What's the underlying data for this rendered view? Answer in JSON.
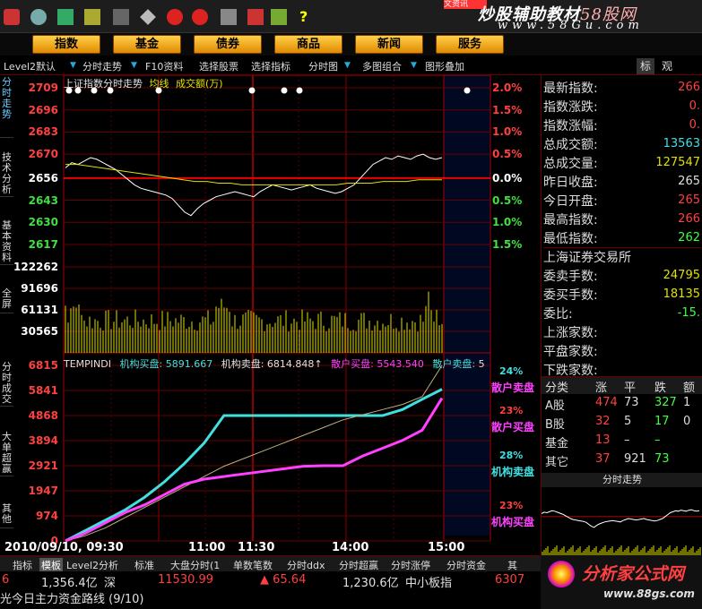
{
  "topbar": {
    "brand_line1": "炒股辅助教材",
    "brand_line1_accent": "58股网",
    "brand_line2": "www.58Gu.com",
    "partial_tab": "文资讯"
  },
  "nav": {
    "items": [
      "指数",
      "基金",
      "债券",
      "商品",
      "新闻",
      "服务"
    ]
  },
  "toolbar": {
    "items": [
      "Level2默认",
      "分时走势",
      "F10资料",
      "选择股票",
      "选择指标",
      "分时图",
      "多图组合",
      "图形叠加"
    ],
    "right_tabs": [
      "标",
      "观"
    ]
  },
  "left_tabs": [
    "分时走势",
    "技术分析",
    "基本资料",
    "全屏",
    "分时成交",
    "大单超赢",
    "其他"
  ],
  "chart": {
    "header": "上证指数分时走势",
    "header_avg": "均线",
    "header_vol": "成交额(万)",
    "price_labels": [
      "2709",
      "2696",
      "2683",
      "2670",
      "2656",
      "2643",
      "2630",
      "2617"
    ],
    "pct_labels": [
      "2.0%",
      "1.5%",
      "1.0%",
      "0.5%",
      "0.0%",
      "0.5%",
      "1.0%",
      "1.5%"
    ],
    "vol_labels": [
      "122262",
      "91696",
      "61131",
      "30565"
    ],
    "indicator_name": "TEMPINDI",
    "ind_legend": [
      {
        "label": "机构买盘:",
        "value": "5891.667",
        "color": "#40e0e0"
      },
      {
        "label": "机构卖盘:",
        "value": "6814.848↑",
        "color": "#e0e0e0"
      },
      {
        "label": "散户买盘:",
        "value": "5543.540",
        "color": "#ff40ff"
      },
      {
        "label": "散户卖盘:",
        "value": "5",
        "color": "#e0e0e0"
      }
    ],
    "ind_labels": [
      "6815",
      "5841",
      "4868",
      "3894",
      "2921",
      "1947",
      "974",
      "0"
    ],
    "ind_right_pcts": [
      "24%",
      "23%",
      "28%",
      "23%"
    ],
    "ind_right_names": [
      "散户卖盘",
      "散户买盘",
      "机构卖盘",
      "机构买盘"
    ],
    "time_labels": [
      "2010/09/10, 09:30",
      "11:00",
      "11:30",
      "14:00",
      "15:00"
    ]
  },
  "chart_data": {
    "type": "line",
    "title": "上证指数分时走势",
    "price_range": [
      2617,
      2709
    ],
    "baseline": 2656,
    "price_series": [
      2662,
      2665,
      2664,
      2666,
      2668,
      2667,
      2665,
      2663,
      2661,
      2658,
      2655,
      2652,
      2650,
      2649,
      2648,
      2647,
      2646,
      2644,
      2640,
      2636,
      2634,
      2638,
      2641,
      2643,
      2645,
      2646,
      2647,
      2648,
      2647,
      2646,
      2645,
      2648,
      2650,
      2652,
      2651,
      2650,
      2649,
      2650,
      2651,
      2652,
      2650,
      2649,
      2648,
      2647,
      2648,
      2650,
      2652,
      2656,
      2660,
      2664,
      2666,
      2668,
      2667,
      2669,
      2668,
      2667,
      2669,
      2670,
      2668,
      2667,
      2668
    ],
    "avg_series": [
      2664,
      2664,
      2663,
      2662,
      2661,
      2660,
      2659,
      2658,
      2657,
      2656,
      2655,
      2654,
      2654,
      2653,
      2653,
      2652,
      2652,
      2652,
      2652,
      2652,
      2652,
      2652,
      2652,
      2652,
      2653,
      2653,
      2653,
      2654,
      2654,
      2654,
      2655,
      2655,
      2655
    ],
    "vol_range": [
      0,
      122262
    ],
    "ind_range": [
      0,
      6815
    ],
    "series": [
      {
        "name": "机构买盘",
        "values": [
          0,
          400,
          800,
          1200,
          1700,
          2300,
          3000,
          3800,
          4868,
          4868,
          4868,
          4868,
          4868,
          4868,
          4868,
          4868,
          4868,
          5100,
          5500,
          5891
        ]
      },
      {
        "name": "机构卖盘",
        "values": [
          0,
          200,
          500,
          900,
          1300,
          1700,
          2100,
          2500,
          2900,
          3200,
          3500,
          3800,
          4100,
          4400,
          4700,
          4900,
          5100,
          5300,
          5600,
          6815
        ]
      },
      {
        "name": "散户买盘",
        "values": [
          0,
          300,
          700,
          1100,
          1400,
          1800,
          2200,
          2400,
          2500,
          2600,
          2700,
          2800,
          2900,
          2921,
          2921,
          3300,
          3600,
          3900,
          4300,
          5543
        ]
      }
    ]
  },
  "right_panel": {
    "rows": [
      {
        "label": "最新指数:",
        "value": "266",
        "color": "#ff4040"
      },
      {
        "label": "指数涨跌:",
        "value": "0.",
        "color": "#ff4040"
      },
      {
        "label": "指数涨幅:",
        "value": "0.",
        "color": "#ff4040"
      },
      {
        "label": "总成交额:",
        "value": "13563",
        "color": "#40e0e0"
      },
      {
        "label": "总成交量:",
        "value": "127547",
        "color": "#e0e000"
      },
      {
        "label": "昨日收盘:",
        "value": "265",
        "color": "#e0e0e0"
      },
      {
        "label": "今日开盘:",
        "value": "265",
        "color": "#ff4040"
      },
      {
        "label": "最高指数:",
        "value": "266",
        "color": "#ff4040"
      },
      {
        "label": "最低指数:",
        "value": "262",
        "color": "#40ff40"
      }
    ],
    "exchange": "上海证券交易所",
    "rows2": [
      {
        "label": "委卖手数:",
        "value": "24795",
        "color": "#e0e000"
      },
      {
        "label": "委买手数:",
        "value": "18135",
        "color": "#e0e000"
      },
      {
        "label": "委比:",
        "value": "-15.",
        "color": "#40ff40"
      },
      {
        "label": "上涨家数:",
        "value": "",
        "color": "#ff4040"
      },
      {
        "label": "平盘家数:",
        "value": "",
        "color": "#e0e0e0"
      },
      {
        "label": "下跌家数:",
        "value": "",
        "color": "#40ff40"
      }
    ],
    "table_headers": [
      "分类",
      "涨",
      "平",
      "跌",
      "额"
    ],
    "table_rows": [
      [
        "A股",
        "474",
        "73",
        "327",
        "1"
      ],
      [
        "B股",
        "32",
        "5",
        "17",
        "0"
      ],
      [
        "基金",
        "13",
        "–",
        "–",
        ""
      ],
      [
        "其它",
        "37",
        "921",
        "73",
        ""
      ]
    ],
    "mini_title": "分时走势"
  },
  "bottom_tabs": [
    "指标",
    "模板",
    "Level2分析",
    "标准",
    "大盘分时(1",
    "单数笔数",
    "分时ddx",
    "分时超赢",
    "分时涨停",
    "分时资金",
    "其"
  ],
  "status": {
    "line1": [
      {
        "text": "6",
        "color": "#ff4040"
      },
      {
        "text": "1,356.4亿",
        "color": "#e0e0e0"
      },
      {
        "text": "深",
        "color": "#e0e0e0"
      },
      {
        "text": "11530.99",
        "color": "#ff4040"
      },
      {
        "text": "▲ 65.64",
        "color": "#ff4040"
      },
      {
        "text": "1,230.6亿",
        "color": "#e0e0e0"
      },
      {
        "text": "中小板指",
        "color": "#e0e0e0"
      },
      {
        "text": "6307",
        "color": "#ff4040"
      }
    ],
    "line2": "光今日主力资金路线 (9/10)"
  },
  "watermark": {
    "title": "分析家公式网",
    "url": "www.88gs.com"
  }
}
